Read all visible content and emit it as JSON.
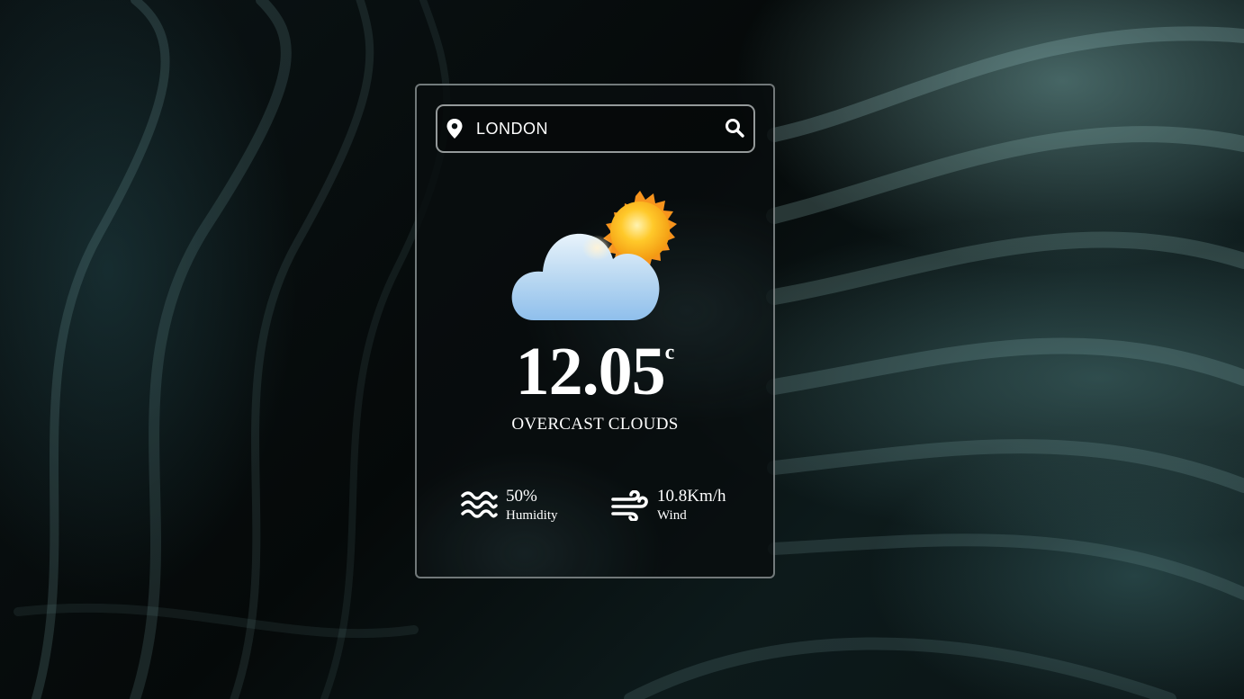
{
  "search": {
    "value": "LONDON",
    "icon": "search-icon",
    "location_icon": "map-pin-icon"
  },
  "weather": {
    "icon": "partly-cloudy-sun-icon",
    "temperature": "12.05",
    "unit": "c",
    "condition": "OVERCAST CLOUDS"
  },
  "stats": {
    "humidity": {
      "value": "50%",
      "label": "Humidity",
      "icon": "water-waves-icon"
    },
    "wind": {
      "value": "10.8Km/h",
      "label": "Wind",
      "icon": "wind-icon"
    }
  },
  "colors": {
    "text": "#ffffff",
    "sun": "#f8a21b",
    "cloud": "#a8cdf0"
  }
}
